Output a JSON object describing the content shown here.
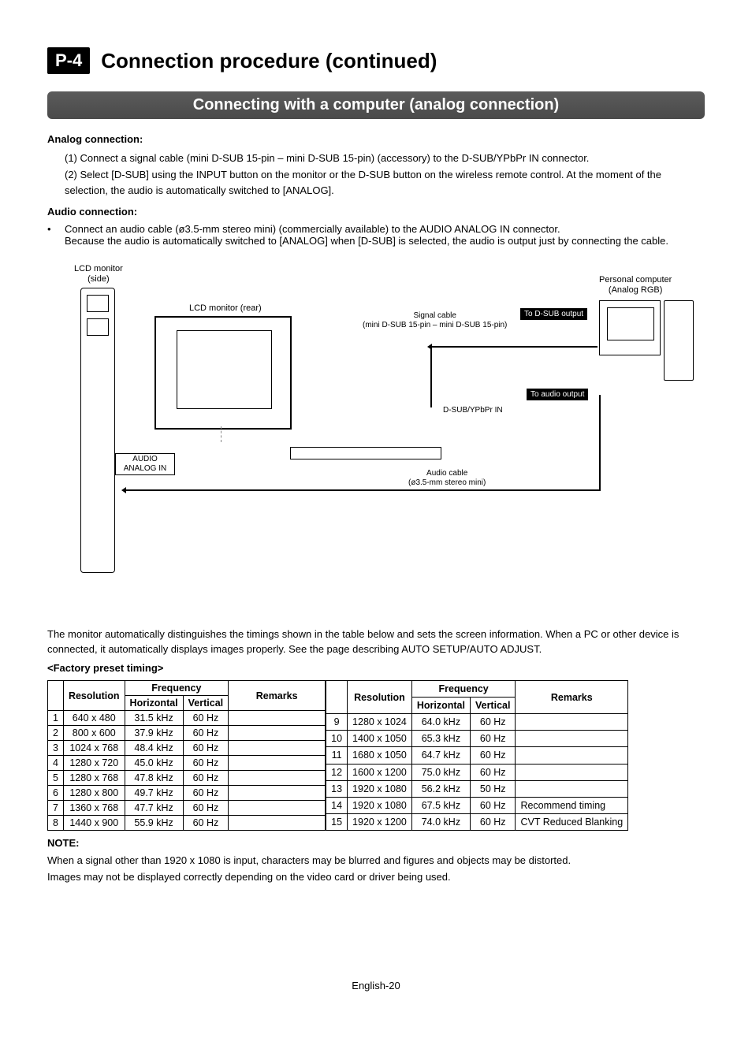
{
  "header": {
    "tag": "P-4",
    "title": "Connection procedure (continued)"
  },
  "banner": "Connecting with a computer (analog connection)",
  "analog": {
    "heading": "Analog connection:",
    "item1": "(1)  Connect a signal cable (mini D-SUB 15-pin – mini D-SUB 15-pin) (accessory) to the D-SUB/YPbPr IN connector.",
    "item2": "(2)  Select [D-SUB] using the INPUT button on the monitor or the D-SUB button on the wireless remote control. At the moment of the selection, the audio is automatically switched to [ANALOG]."
  },
  "audio": {
    "heading": "Audio connection:",
    "bullet1": "Connect an audio cable (ø3.5-mm stereo mini) (commercially available) to the AUDIO ANALOG IN connector.",
    "bullet2": "Because the audio is automatically switched to [ANALOG] when [D-SUB] is selected, the audio is output just by connecting the cable."
  },
  "diagram": {
    "lcd_side_label": "LCD monitor\n(side)",
    "lcd_rear_label": "LCD monitor (rear)",
    "pc_label": "Personal computer\n(Analog RGB)",
    "signal_cable": "Signal cable\n(mini D-SUB 15-pin – mini D-SUB 15-pin)",
    "to_dsub": "To D-SUB output",
    "to_audio": "To audio output",
    "dsub_in": "D-SUB/YPbPr IN",
    "audio_cable": "Audio cable\n(ø3.5-mm stereo mini)",
    "audio_analog_in": "AUDIO\nANALOG IN"
  },
  "preset_intro": "The monitor automatically distinguishes the timings shown in the table below and sets the screen information. When a PC or other device is connected, it automatically displays images properly. See the page describing AUTO SETUP/AUTO ADJUST.",
  "preset_heading": "<Factory preset timing>",
  "table_headers": {
    "num": "",
    "resolution": "Resolution",
    "frequency": "Frequency",
    "horizontal": "Horizontal",
    "vertical": "Vertical",
    "remarks": "Remarks"
  },
  "left_rows": [
    {
      "n": "1",
      "res": "640 x 480",
      "h": "31.5 kHz",
      "v": "60 Hz",
      "r": ""
    },
    {
      "n": "2",
      "res": "800 x 600",
      "h": "37.9 kHz",
      "v": "60 Hz",
      "r": ""
    },
    {
      "n": "3",
      "res": "1024 x 768",
      "h": "48.4 kHz",
      "v": "60 Hz",
      "r": ""
    },
    {
      "n": "4",
      "res": "1280 x 720",
      "h": "45.0 kHz",
      "v": "60 Hz",
      "r": ""
    },
    {
      "n": "5",
      "res": "1280 x 768",
      "h": "47.8 kHz",
      "v": "60 Hz",
      "r": ""
    },
    {
      "n": "6",
      "res": "1280 x 800",
      "h": "49.7 kHz",
      "v": "60 Hz",
      "r": ""
    },
    {
      "n": "7",
      "res": "1360 x 768",
      "h": "47.7 kHz",
      "v": "60 Hz",
      "r": ""
    },
    {
      "n": "8",
      "res": "1440 x 900",
      "h": "55.9 kHz",
      "v": "60 Hz",
      "r": ""
    }
  ],
  "right_rows": [
    {
      "n": "9",
      "res": "1280 x 1024",
      "h": "64.0 kHz",
      "v": "60 Hz",
      "r": ""
    },
    {
      "n": "10",
      "res": "1400 x 1050",
      "h": "65.3 kHz",
      "v": "60 Hz",
      "r": ""
    },
    {
      "n": "11",
      "res": "1680 x 1050",
      "h": "64.7 kHz",
      "v": "60 Hz",
      "r": ""
    },
    {
      "n": "12",
      "res": "1600 x 1200",
      "h": "75.0 kHz",
      "v": "60 Hz",
      "r": ""
    },
    {
      "n": "13",
      "res": "1920 x 1080",
      "h": "56.2 kHz",
      "v": "50 Hz",
      "r": ""
    },
    {
      "n": "14",
      "res": "1920 x 1080",
      "h": "67.5 kHz",
      "v": "60 Hz",
      "r": "Recommend timing"
    },
    {
      "n": "15",
      "res": "1920 x 1200",
      "h": "74.0 kHz",
      "v": "60 Hz",
      "r": "CVT Reduced Blanking"
    }
  ],
  "note": {
    "heading": "NOTE:",
    "line1": "When a signal other than 1920 x 1080 is input, characters may be blurred and figures and objects may be distorted.",
    "line2": "Images may not be displayed correctly depending on the video card or driver being used."
  },
  "footer": "English-20"
}
